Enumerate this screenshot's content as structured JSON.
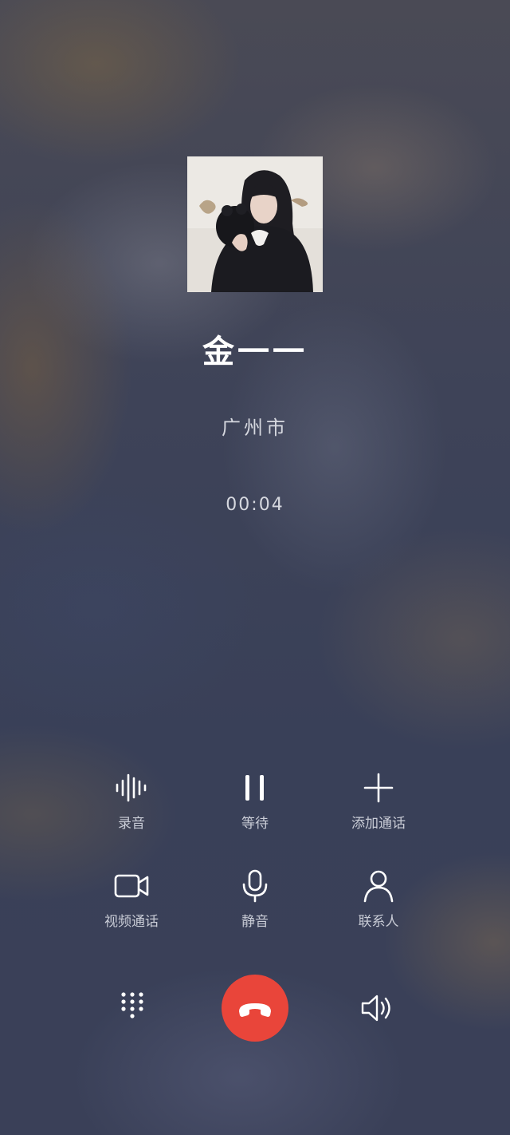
{
  "call": {
    "contact_name": "金一一",
    "location": "广州市",
    "duration": "00:04"
  },
  "actions": [
    {
      "id": "record",
      "label": "录音",
      "icon": "waveform-icon"
    },
    {
      "id": "hold",
      "label": "等待",
      "icon": "pause-icon"
    },
    {
      "id": "add_call",
      "label": "添加通话",
      "icon": "plus-icon"
    },
    {
      "id": "video_call",
      "label": "视频通话",
      "icon": "video-camera-icon"
    },
    {
      "id": "mute",
      "label": "静音",
      "icon": "microphone-icon"
    },
    {
      "id": "contacts",
      "label": "联系人",
      "icon": "person-icon"
    }
  ],
  "bottom_bar": {
    "keypad_icon": "dialpad-icon",
    "hangup_icon": "phone-hangup-icon",
    "speaker_icon": "speaker-icon"
  },
  "colors": {
    "hangup": "#e9453a",
    "text_primary": "#ffffff",
    "text_secondary": "#c9ccd6"
  }
}
